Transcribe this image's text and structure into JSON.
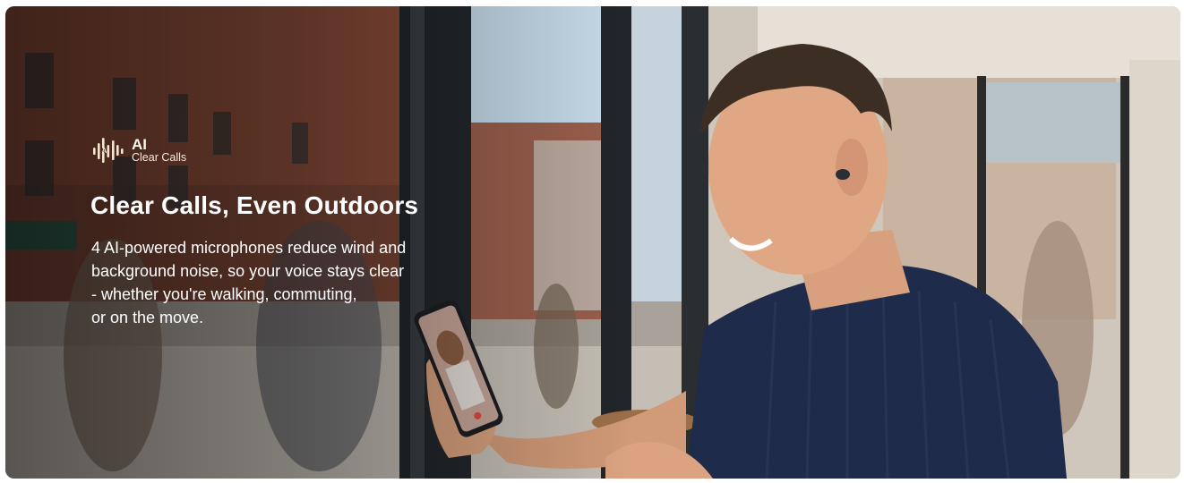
{
  "feature_badge": {
    "icon": "ai-soundwave-icon",
    "title": "AI",
    "subtitle": "Clear Calls",
    "color": "#f5e6cf"
  },
  "headline": "Clear Calls, Even Outdoors",
  "description_lines": [
    "4 AI-powered microphones reduce wind and",
    "background noise, so your voice stays clear",
    "- whether you're walking, commuting,",
    "or on the move."
  ]
}
